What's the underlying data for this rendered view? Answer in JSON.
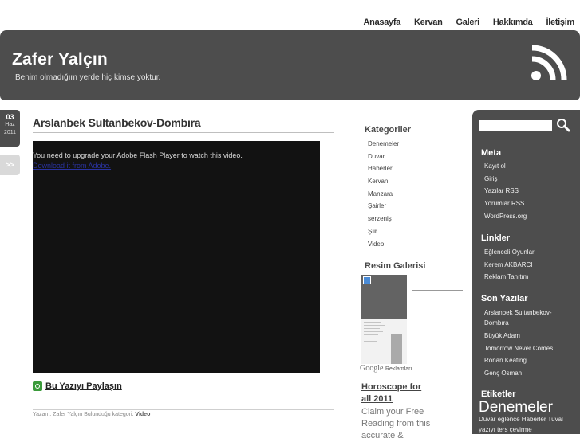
{
  "nav": [
    "Anasayfa",
    "Kervan",
    "Galeri",
    "Hakkımda",
    "İletişim"
  ],
  "site": {
    "title": "Zafer Yalçın",
    "description": "Benim olmadığım yerde hiç kimse yoktur."
  },
  "date": {
    "day": "03",
    "month": "Haz",
    "year": "2011"
  },
  "next_label": ">>",
  "post": {
    "title": "Arslanbek Sultanbekov-Dombıra",
    "video_message": "You need to upgrade your Adobe Flash Player to watch this video.",
    "video_link": "Download it from Adobe.",
    "share_label": "Bu Yazıyı Paylaşın",
    "meta_prefix": "Yazan : Zafer Yalçın Bulunduğu kategori:",
    "meta_category": "Video"
  },
  "categories": {
    "heading": "Kategoriler",
    "items": [
      "Denemeler",
      "Duvar",
      "Haberler",
      "Kervan",
      "Manzara",
      "Şairler",
      "serzeniş",
      "Şiir",
      "Video"
    ]
  },
  "gallery": {
    "heading": "Resim Galerisi"
  },
  "ads": {
    "google": "Google",
    "google_suffix": "Reklamları",
    "title": "Horoscope for all 2011",
    "text": "Claim your Free Reading from this accurate &"
  },
  "sidebar": {
    "meta": {
      "heading": "Meta",
      "items": [
        "Kayıt ol",
        "Giriş",
        "Yazılar RSS",
        "Yorumlar RSS",
        "WordPress.org"
      ]
    },
    "links": {
      "heading": "Linkler",
      "items": [
        "Eğlenceli Oyunlar",
        "Kerem AKBARCI",
        "Reklam Tanıtım"
      ]
    },
    "recent": {
      "heading": "Son Yazılar",
      "items": [
        "Arslanbek Sultanbekov-Dombıra",
        "Büyük Adam",
        "Tomorrow Never Comes",
        "Ronan Keating",
        "Genç Osman"
      ]
    },
    "tags": {
      "heading": "Etiketler",
      "big": "Denemeler",
      "small": "Duvar eğlence Haberler Tuval yazıyı ters çevirme"
    }
  },
  "colors": {
    "header_bg": "#4d4d4d",
    "text_dark": "#333333",
    "link_blue": "#2a33a0"
  }
}
